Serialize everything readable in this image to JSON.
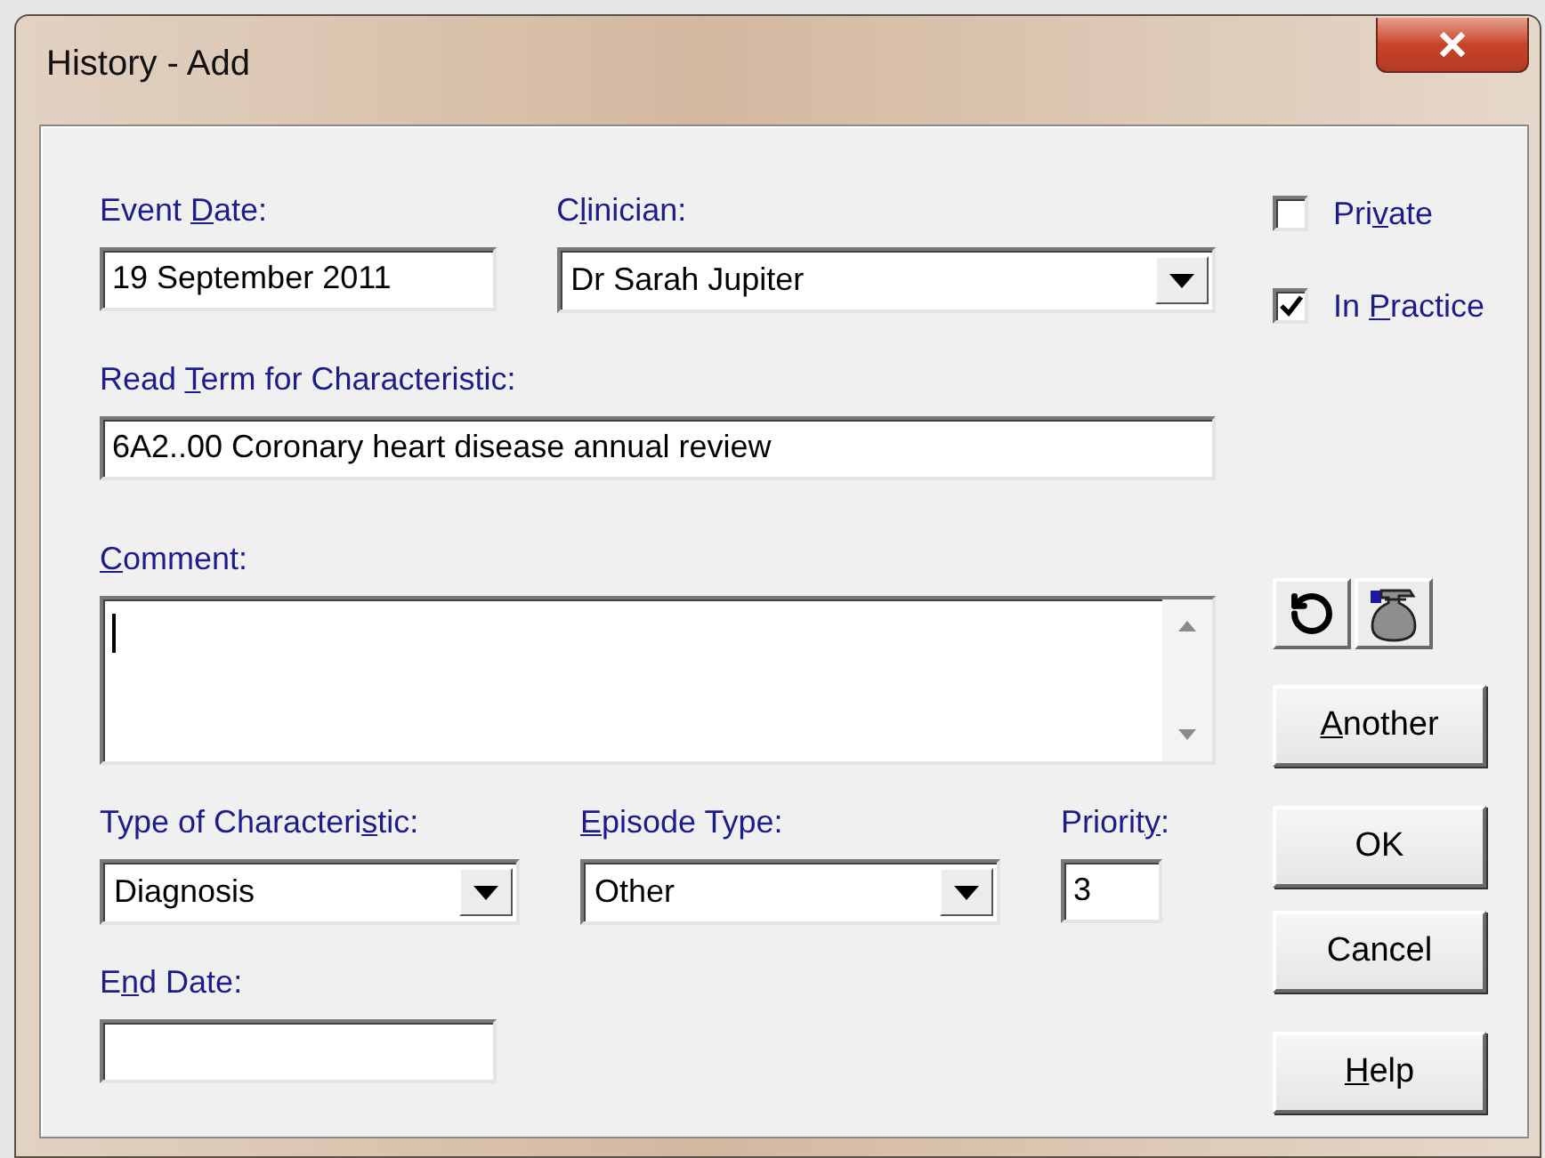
{
  "window": {
    "title": "History - Add"
  },
  "event_date": {
    "label": {
      "before": "Event ",
      "key": "D",
      "after": "ate:"
    },
    "value": "19 September 2011"
  },
  "clinician": {
    "label": {
      "before": "C",
      "key": "l",
      "after": "inician:"
    },
    "value": "Dr Sarah Jupiter"
  },
  "checkboxes": [
    {
      "label": {
        "before": "Pri",
        "key": "v",
        "after": "ate"
      },
      "checked": false
    },
    {
      "label": {
        "before": "In ",
        "key": "P",
        "after": "ractice"
      },
      "checked": true
    }
  ],
  "read_term": {
    "label": {
      "before": "Read ",
      "key": "T",
      "after": "erm for Characteristic:"
    },
    "value": "6A2..00 Coronary heart disease annual review"
  },
  "comment": {
    "label": {
      "key": "C",
      "after": "omment:"
    }
  },
  "type_of_characteristic": {
    "label": {
      "before": "Type of Characteri",
      "key": "s",
      "after": "tic:"
    },
    "value": "Diagnosis"
  },
  "episode_type": {
    "label": {
      "key": "E",
      "after": "pisode Type:"
    },
    "value": "Other"
  },
  "priority": {
    "label": {
      "before": "Priorit",
      "key": "y",
      "after": ":"
    },
    "value": "3"
  },
  "end_date": {
    "label": {
      "before": "E",
      "key": "n",
      "after": "d Date:"
    }
  },
  "buttons": [
    {
      "kind": "another",
      "key": "A",
      "after": "nother"
    },
    {
      "kind": "ok",
      "before": "OK"
    },
    {
      "kind": "cancel",
      "before": "Cancel"
    },
    {
      "kind": "help",
      "key": "H",
      "after": "elp"
    }
  ]
}
